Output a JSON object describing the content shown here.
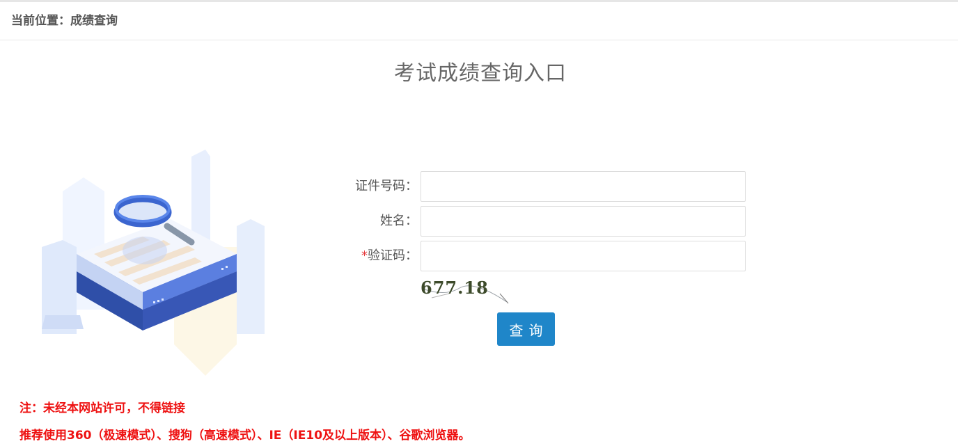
{
  "breadcrumb": {
    "text": "当前位置：成绩查询"
  },
  "page": {
    "title": "考试成绩查询入口"
  },
  "form": {
    "id_label": "证件号码：",
    "name_label": "姓名：",
    "captcha_required_mark": "*",
    "captcha_label": "验证码：",
    "id_value": "",
    "name_value": "",
    "captcha_value": "",
    "captcha_image_text": "677.18",
    "submit_label": "查询"
  },
  "notices": {
    "line1": "注：未经本网站许可，不得链接",
    "line2": "推荐使用360（极速模式）、搜狗（高速模式）、IE（IE10及以上版本）、谷歌浏览器。"
  },
  "colors": {
    "accent": "#1f86c9",
    "notice": "#ee1111",
    "required": "#e4393c"
  },
  "icons": [
    "magnifier-search-illustration"
  ]
}
